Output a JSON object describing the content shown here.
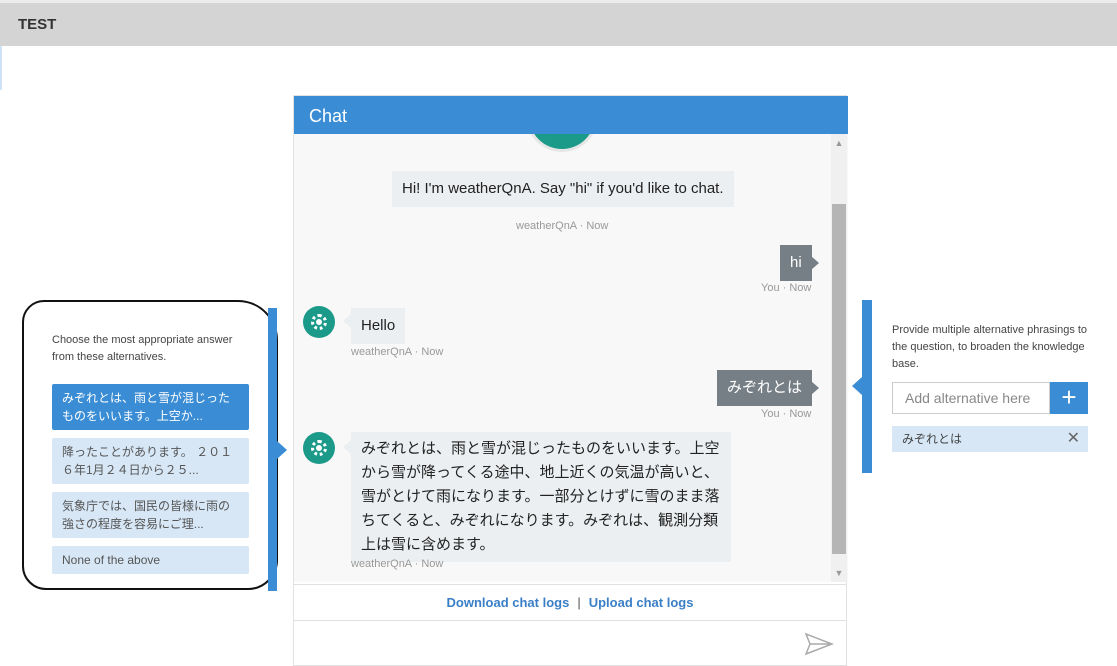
{
  "app": {
    "title": "TEST"
  },
  "chat": {
    "header": "Chat",
    "messages": [
      {
        "from": "bot",
        "text": "Hi! I'm weatherQnA. Say \"hi\" if you'd like to chat.",
        "meta": "weatherQnA · Now"
      },
      {
        "from": "user",
        "text": "hi",
        "meta": "You · Now"
      },
      {
        "from": "bot",
        "text": "Hello",
        "meta": "weatherQnA · Now"
      },
      {
        "from": "user",
        "text": "みぞれとは",
        "meta": "You · Now"
      },
      {
        "from": "bot",
        "text": "みぞれとは、雨と雪が混じったものをいいます。上空から雪が降ってくる途中、地上近くの気温が高いと、雪がとけて雨になります。一部分とけずに雪のまま落ちてくると、みぞれになります。みぞれは、観測分類上は雪に含めます。",
        "meta": "weatherQnA · Now"
      }
    ],
    "download_logs": "Download chat logs",
    "separator": "|",
    "upload_logs": "Upload chat logs",
    "input_value": ""
  },
  "alternatives_panel": {
    "description": "Choose the most appropriate answer from these alternatives.",
    "options": [
      {
        "text": "みぞれとは、雨と雪が混じったものをいいます。上空か...",
        "selected": true
      },
      {
        "text": "降ったことがあります。 ２０１６年1月２４日から２５...",
        "selected": false
      },
      {
        "text": "気象庁では、国民の皆様に雨の強さの程度を容易にご理...",
        "selected": false
      },
      {
        "text": "None of the above",
        "selected": false
      }
    ]
  },
  "phrasing_panel": {
    "description": "Provide multiple alternative phrasings to the question, to broaden the knowledge base.",
    "input_placeholder": "Add alternative here",
    "add_label": "+",
    "tags": [
      {
        "text": "みぞれとは",
        "remove": "✕"
      }
    ]
  },
  "colors": {
    "accent": "#3a8dd4",
    "bot_avatar": "#1b9a8a",
    "user_bubble": "#777f86",
    "bot_bubble": "#eceff1"
  }
}
